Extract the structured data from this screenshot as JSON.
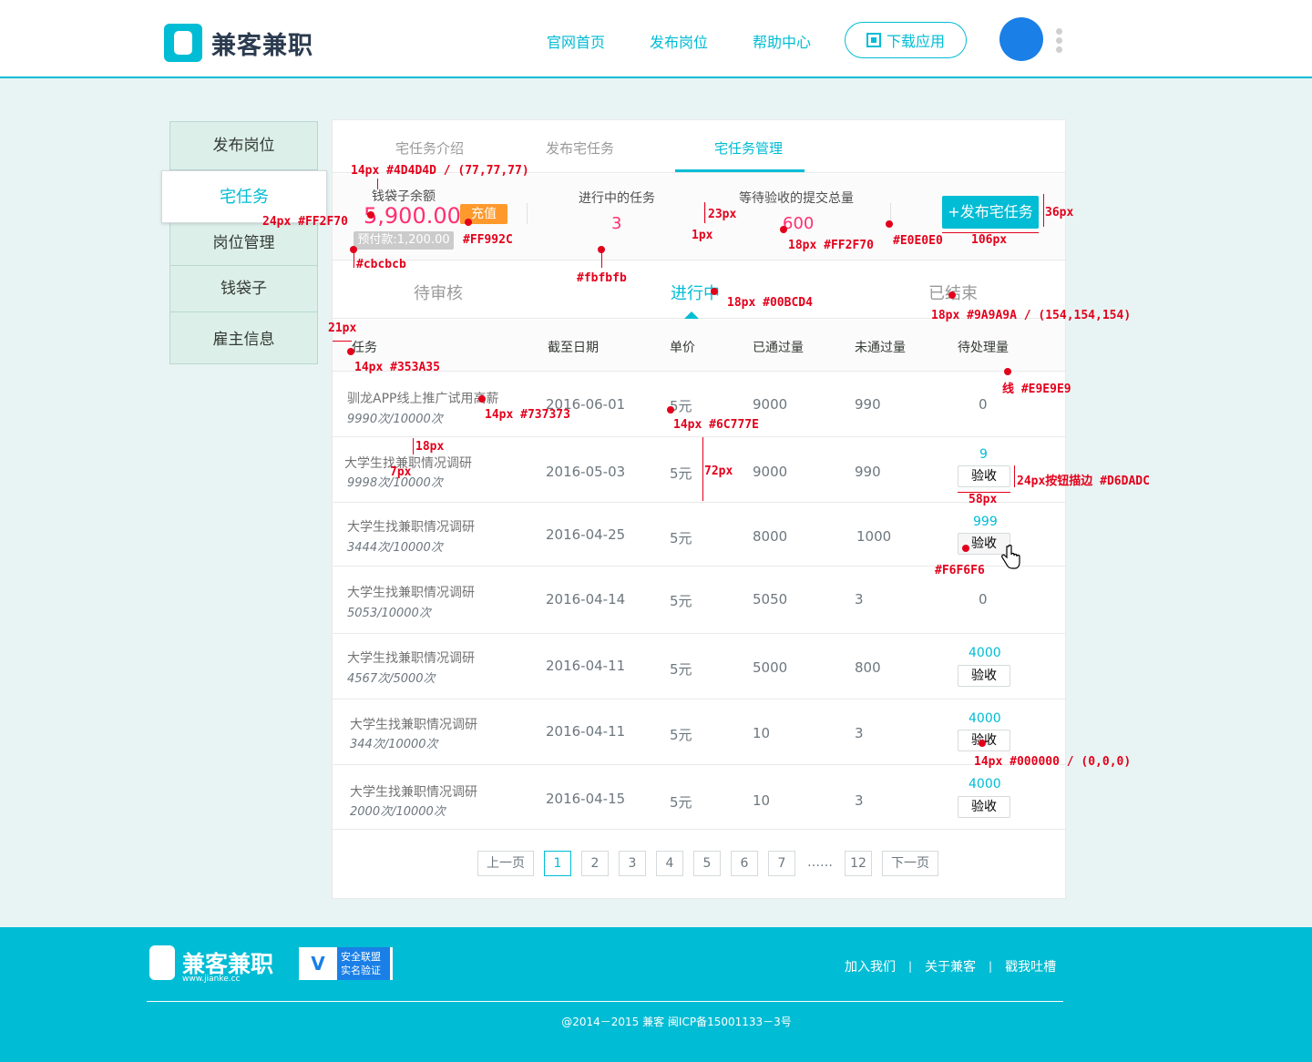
{
  "header": {
    "logo": "兼客兼职",
    "nav": [
      "官网首页",
      "发布岗位",
      "帮助中心"
    ],
    "download": "下载应用"
  },
  "sidebar": {
    "items": [
      "发布岗位",
      "宅任务",
      "岗位管理",
      "钱袋子",
      "雇主信息"
    ]
  },
  "tabs": [
    "宅任务介绍",
    "发布宅任务",
    "宅任务管理"
  ],
  "stats": {
    "balance_label": "钱袋子余额",
    "balance": "5,900.00",
    "recharge": "充值",
    "prepaid": "预付款:1,200.00",
    "in_progress_label": "进行中的任务",
    "in_progress": "3",
    "pending_label": "等待验收的提交总量",
    "pending": "600",
    "publish": "+发布宅任务"
  },
  "subtabs": [
    "待审核",
    "进行中",
    "已结束"
  ],
  "table": {
    "headers": [
      "任务",
      "截至日期",
      "单价",
      "已通过量",
      "未通过量",
      "待处理量"
    ],
    "accept_label": "验收",
    "rows": [
      {
        "title": "驯龙APP线上推广试用高薪",
        "sub": "9990次/10000次",
        "date": "2016-06-01",
        "price": "5元",
        "passed": "9000",
        "failed": "990",
        "pending": "0"
      },
      {
        "title": "大学生找兼职情况调研",
        "sub": "9998次/10000次",
        "date": "2016-05-03",
        "price": "5元",
        "passed": "9000",
        "failed": "990",
        "pending": "9"
      },
      {
        "title": "大学生找兼职情况调研",
        "sub": "3444次/10000次",
        "date": "2016-04-25",
        "price": "5元",
        "passed": "8000",
        "failed": "1000",
        "pending": "999"
      },
      {
        "title": "大学生找兼职情况调研",
        "sub": "5053/10000次",
        "date": "2016-04-14",
        "price": "5元",
        "passed": "5050",
        "failed": "3",
        "pending": "0"
      },
      {
        "title": "大学生找兼职情况调研",
        "sub": "4567次/5000次",
        "date": "2016-04-11",
        "price": "5元",
        "passed": "5000",
        "failed": "800",
        "pending": "4000"
      },
      {
        "title": "大学生找兼职情况调研",
        "sub": "344次/10000次",
        "date": "2016-04-11",
        "price": "5元",
        "passed": "10",
        "failed": "3",
        "pending": "4000"
      },
      {
        "title": "大学生找兼职情况调研",
        "sub": "2000次/10000次",
        "date": "2016-04-15",
        "price": "5元",
        "passed": "10",
        "failed": "3",
        "pending": "4000"
      }
    ]
  },
  "pager": {
    "prev": "上一页",
    "pages": [
      "1",
      "2",
      "3",
      "4",
      "5",
      "6",
      "7"
    ],
    "ellipsis": "……",
    "last": "12",
    "next": "下一页"
  },
  "annotations": {
    "a1": "14px #4D4D4D / (77,77,77)",
    "a2": "24px #FF2F70",
    "a3": "#FF992C",
    "a4": "#cbcbcb",
    "a5": "#fbfbfb",
    "a6": "23px",
    "a7": "1px",
    "a8": "18px #FF2F70",
    "a9": "#E0E0E0",
    "a10": "36px",
    "a11": "106px",
    "a12": "18px #00BCD4",
    "a13": "18px #9A9A9A / (154,154,154)",
    "a14": "21px",
    "a15": "14px #353A35",
    "a16": "线 #E9E9E9",
    "a17": "14px #737373",
    "a18": "14px #6C777E",
    "a19": "18px",
    "a20": "7px",
    "a21": "72px",
    "a22": "24px按钮描边 #D6DADC",
    "a23": "58px",
    "a24": "#F6F6F6",
    "a25": "14px #000000 / (0,0,0)"
  },
  "footer": {
    "logo": "兼客兼职",
    "url": "www.jianke.cc",
    "badge_v": "V",
    "badge_text": "安全联盟 实名验证",
    "links": [
      "加入我们",
      "关于兼客",
      "戳我吐槽"
    ],
    "copyright": "@2014－2015  兼客  闽ICP备15001133－3号"
  },
  "colors": {
    "accent": "#00BCD4",
    "price": "#FF2F70",
    "recharge": "#FF992C",
    "annotation": "#E3001B"
  }
}
